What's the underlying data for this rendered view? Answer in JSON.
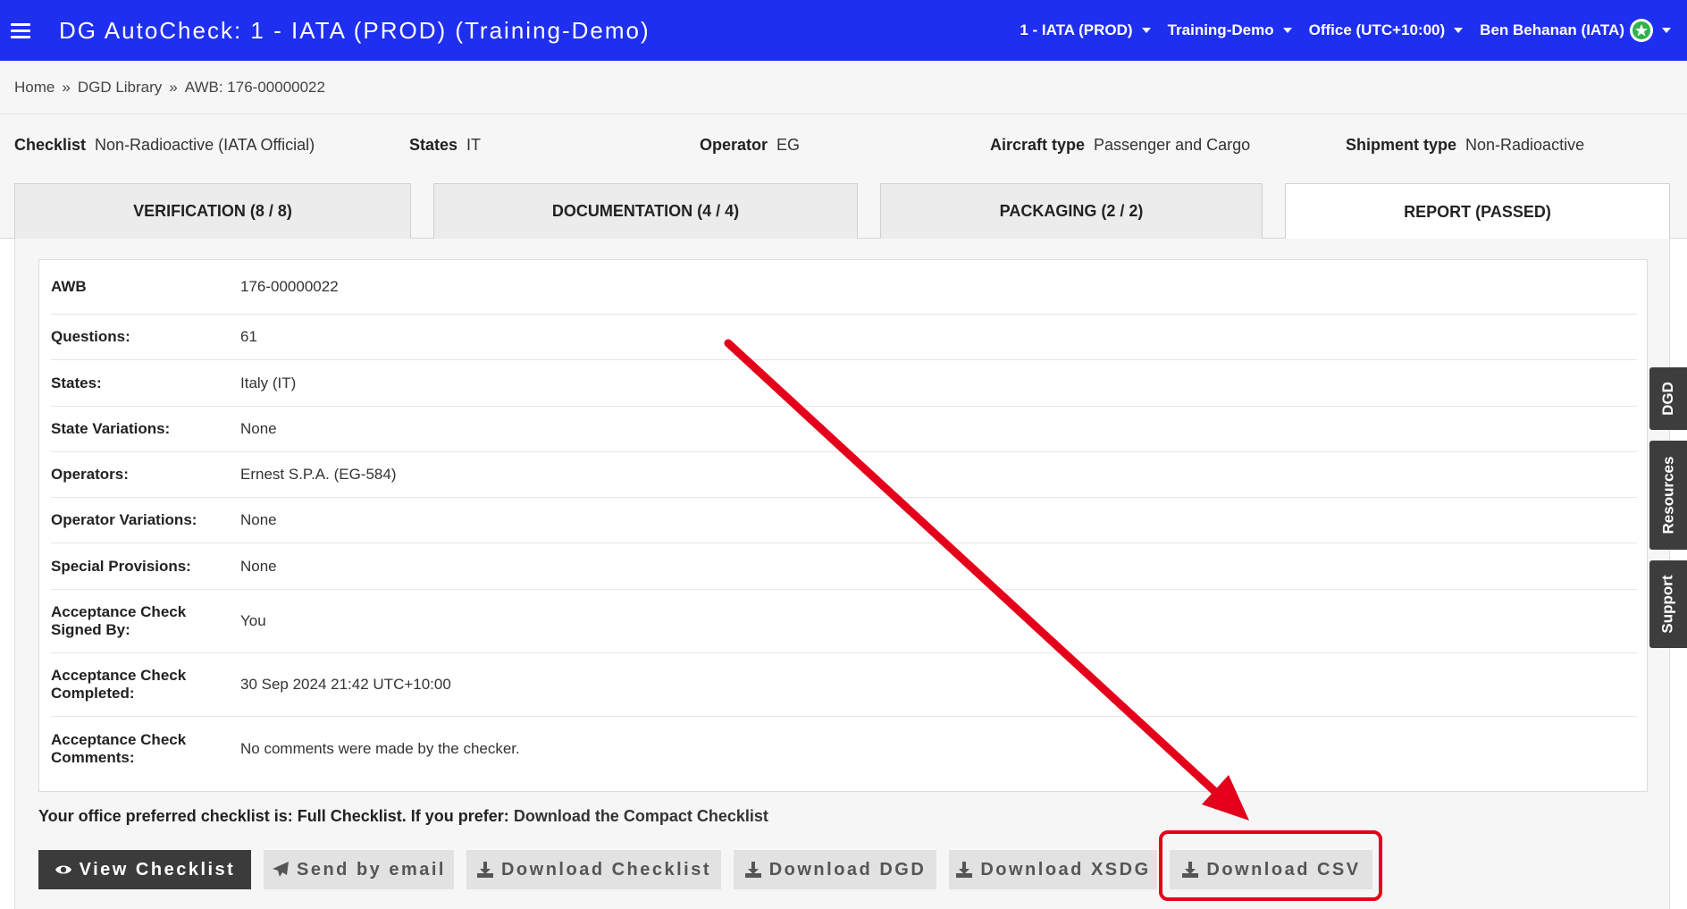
{
  "header": {
    "app_title": "DG AutoCheck: 1 - IATA (PROD) (Training-Demo)",
    "menus": [
      {
        "label": "1 - IATA (PROD)"
      },
      {
        "label": "Training-Demo"
      },
      {
        "label": "Office (UTC+10:00)"
      },
      {
        "label": "Ben Behanan (IATA)"
      }
    ],
    "badge_color": "#2db34a"
  },
  "breadcrumb": {
    "items": [
      "Home",
      "DGD Library",
      "AWB: 176-00000022"
    ],
    "separator": "»"
  },
  "info": {
    "checklist_label": "Checklist",
    "checklist_value": "Non-Radioactive (IATA Official)",
    "states_label": "States",
    "states_value": "IT",
    "operator_label": "Operator",
    "operator_value": "EG",
    "aircraft_label": "Aircraft type",
    "aircraft_value": "Passenger and Cargo",
    "shipment_label": "Shipment type",
    "shipment_value": "Non-Radioactive"
  },
  "tabs": [
    {
      "label": "VERIFICATION (8 / 8)"
    },
    {
      "label": "DOCUMENTATION (4 / 4)"
    },
    {
      "label": "PACKAGING (2 / 2)"
    },
    {
      "label": "REPORT (PASSED)",
      "active": true
    }
  ],
  "report": {
    "rows": [
      {
        "label": "AWB",
        "value": "176-00000022"
      },
      {
        "label": "Questions:",
        "value": "61"
      },
      {
        "label": "States:",
        "value": "Italy (IT)"
      },
      {
        "label": "State Variations:",
        "value": "None"
      },
      {
        "label": "Operators:",
        "value": "Ernest S.P.A. (EG-584)"
      },
      {
        "label": "Operator Variations:",
        "value": "None"
      },
      {
        "label": "Special Provisions:",
        "value": "None"
      },
      {
        "label": "Acceptance Check Signed By:",
        "value": "You"
      },
      {
        "label": "Acceptance Check Completed:",
        "value": "30 Sep 2024 21:42 UTC+10:00"
      },
      {
        "label": "Acceptance Check Comments:",
        "value": "No comments were made by the checker."
      }
    ]
  },
  "preference": {
    "text": "Your office preferred checklist is: Full Checklist. If you prefer:",
    "link": "Download the Compact Checklist"
  },
  "buttons": {
    "view_checklist": "View Checklist",
    "send_email": "Send by email",
    "download_checklist": "Download Checklist",
    "download_dgd": "Download DGD",
    "download_xsdg": "Download XSDG",
    "download_csv": "Download CSV"
  },
  "side_tabs": {
    "dgd": "DGD",
    "resources": "Resources",
    "support": "Support"
  },
  "annotation_color": "#e4001a"
}
